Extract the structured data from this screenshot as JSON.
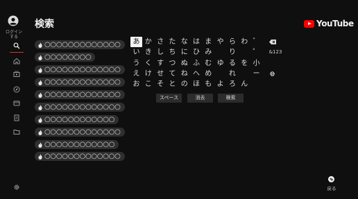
{
  "header": {
    "title": "検索",
    "logo_text": "YouTube",
    "brand_color": "#ff0000"
  },
  "nav": {
    "login_label": "ログイン\nする",
    "items": [
      {
        "name": "search-icon",
        "active": true
      },
      {
        "name": "home-icon",
        "active": false
      },
      {
        "name": "subscriptions-icon",
        "active": false
      },
      {
        "name": "explore-icon",
        "active": false
      },
      {
        "name": "library-icon",
        "active": false
      },
      {
        "name": "saved-icon",
        "active": false
      },
      {
        "name": "folder-icon",
        "active": false
      }
    ],
    "settings_icon": "gear-icon",
    "accent_color": "#e03030"
  },
  "suggestions": [
    "○○○○○○○○○○○○○",
    "○○○○○○○○",
    "○○○○○○○○○○○○○",
    "○○○○○○○○○○○○○",
    "○○○○○○○○○○○○○",
    "○○○○○○○○○○○○○",
    "○○○○○○○○○○○○",
    "○○○○○○○○○○○○○",
    "○○○○○○○○○○○○",
    "○○○○○○○○○○○○○"
  ],
  "keyboard": {
    "selected": "あ",
    "rows": [
      [
        "あ",
        "か",
        "さ",
        "た",
        "な",
        "は",
        "ま",
        "や",
        "ら",
        "わ",
        "゛"
      ],
      [
        "い",
        "き",
        "し",
        "ち",
        "に",
        "ひ",
        "み",
        "",
        "り",
        "",
        "゜"
      ],
      [
        "う",
        "く",
        "す",
        "つ",
        "ぬ",
        "ふ",
        "む",
        "ゆ",
        "る",
        "を",
        "小"
      ],
      [
        "え",
        "け",
        "せ",
        "て",
        "ね",
        "へ",
        "め",
        "",
        "れ",
        "",
        "ー"
      ],
      [
        "お",
        "こ",
        "そ",
        "と",
        "の",
        "ほ",
        "も",
        "よ",
        "ろ",
        "ん",
        ""
      ]
    ],
    "side_keys": {
      "backspace_icon": "backspace-icon",
      "symbols_label": "&123",
      "globe_icon": "globe-icon"
    },
    "actions": {
      "space": "スペース",
      "clear": "消去",
      "search": "検索"
    }
  },
  "back": {
    "label": "戻る",
    "icon": "back-icon"
  }
}
